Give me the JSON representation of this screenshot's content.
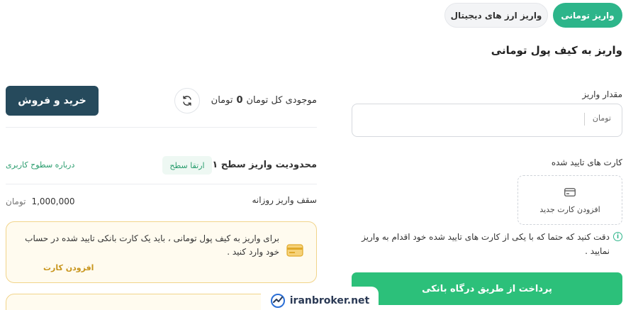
{
  "tabs": [
    {
      "label": "واریز تومانی",
      "active": true
    },
    {
      "label": "واریز ارز های دیجیتال",
      "active": false
    }
  ],
  "page_title": "واریز به کیف پول تومانی",
  "deposit": {
    "amount_label": "مقدار واریز",
    "amount_unit": "تومان",
    "amount_value": "",
    "cards_label": "کارت های تایید شده",
    "add_card_label": "افزودن کارت جدید",
    "notice": "دقت کنید که حتما که با یکی از کارت های تایید شده خود اقدام به واریز نمایید .",
    "pay_button": "پرداخت از طریق درگاه بانکی"
  },
  "summary": {
    "trade_button": "خرید و فروش",
    "balance_label": "موجودی کل تومان",
    "balance_value": "0",
    "balance_unit": "تومان",
    "limit_title": "محدودیت واریز سطح ۱",
    "upgrade_label": "ارتقا سطح",
    "levels_link": "درباره سطوح کاربری",
    "daily_label": "سقف واریز روزانه",
    "daily_value": "1,000,000",
    "daily_unit": "تومان",
    "warning_text": "برای واریز به کیف پول تومانی ، باید یک کارت بانکی تایید شده در حساب خود وارد کنید .",
    "warning_link": "افزودن کارت"
  },
  "watermark": {
    "text": "iranbroker.net"
  },
  "colors": {
    "accent": "#2db58a",
    "pay_button": "#2cc07a",
    "trade_button": "#264a5c",
    "warning_bg": "#fffbef",
    "warning_border": "#f1d48a",
    "warning_link": "#c8951c"
  }
}
